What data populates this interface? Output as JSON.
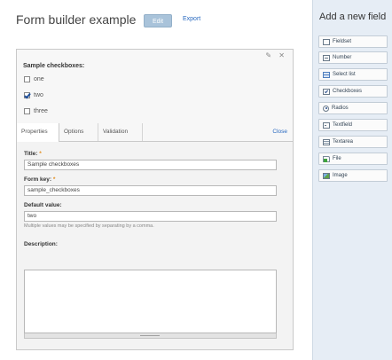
{
  "header": {
    "title": "Form builder example",
    "edit_label": "Edit",
    "export_label": "Export"
  },
  "builder": {
    "tools_label": "✎ ✕",
    "preview": {
      "title": "Sample checkboxes:",
      "options": [
        {
          "label": "one",
          "checked": false
        },
        {
          "label": "two",
          "checked": true
        },
        {
          "label": "three",
          "checked": false
        }
      ]
    },
    "tabs": [
      {
        "label": "Properties",
        "active": true
      },
      {
        "label": "Options",
        "active": false
      },
      {
        "label": "Validation",
        "active": false
      }
    ],
    "close_label": "Close",
    "form": {
      "title_label": "Title:",
      "title_value": "Sample checkboxes",
      "key_label": "Form key:",
      "key_value": "sample_checkboxes",
      "default_label": "Default value:",
      "default_value": "two",
      "default_help": "Multiple values may be specified by separating by a comma.",
      "description_label": "Description:",
      "description_value": "",
      "required_marker": "*"
    }
  },
  "sidebar": {
    "title": "Add a new field",
    "items": [
      {
        "label": "Fieldset",
        "icon": "fieldset-icon"
      },
      {
        "label": "Number",
        "icon": "number-icon"
      },
      {
        "label": "Select list",
        "icon": "select-list-icon"
      },
      {
        "label": "Checkboxes",
        "icon": "checkboxes-icon"
      },
      {
        "label": "Radios",
        "icon": "radios-icon"
      },
      {
        "label": "Textfield",
        "icon": "textfield-icon"
      },
      {
        "label": "Textarea",
        "icon": "textarea-icon"
      },
      {
        "label": "File",
        "icon": "file-icon"
      },
      {
        "label": "Image",
        "icon": "image-icon"
      }
    ]
  },
  "colors": {
    "edit_button": "#a9c3da",
    "link": "#2a6ac0",
    "required": "#e28b1a",
    "sidebar_bg": "#e6edf5"
  }
}
